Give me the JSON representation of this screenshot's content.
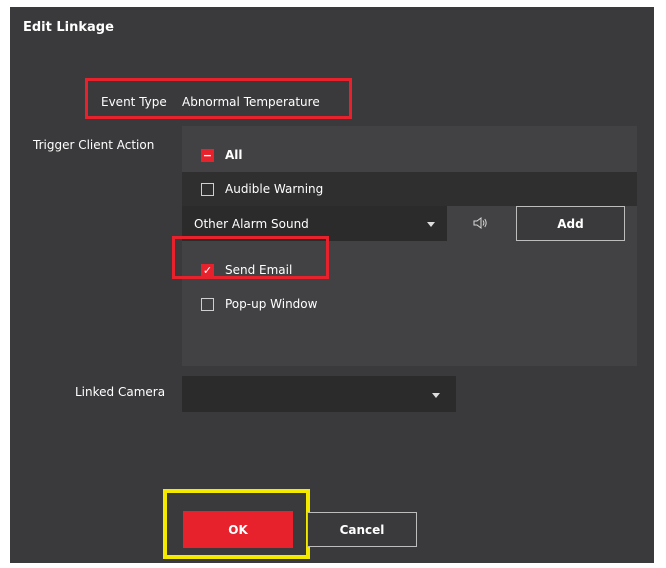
{
  "dialog": {
    "title": "Edit Linkage"
  },
  "event_type": {
    "label": "Event Type",
    "value": "Abnormal Temperature"
  },
  "trigger_client_action": {
    "label": "Trigger Client Action",
    "all": {
      "label": "All",
      "state": "indeterminate"
    },
    "audible_warning": {
      "label": "Audible Warning",
      "checked": false
    },
    "alarm_sound": {
      "selected": "Other Alarm Sound",
      "icon": "speaker-icon",
      "add_label": "Add"
    },
    "send_email": {
      "label": "Send Email",
      "checked": true
    },
    "popup_window": {
      "label": "Pop-up Window",
      "checked": false
    }
  },
  "linked_camera": {
    "label": "Linked Camera",
    "selected": ""
  },
  "footer": {
    "ok_label": "OK",
    "cancel_label": "Cancel"
  },
  "colors": {
    "accent": "#e8222c",
    "highlight_red": "#e8222c",
    "highlight_yellow": "#f4ea00",
    "dialog_bg": "#3a3a3c"
  }
}
